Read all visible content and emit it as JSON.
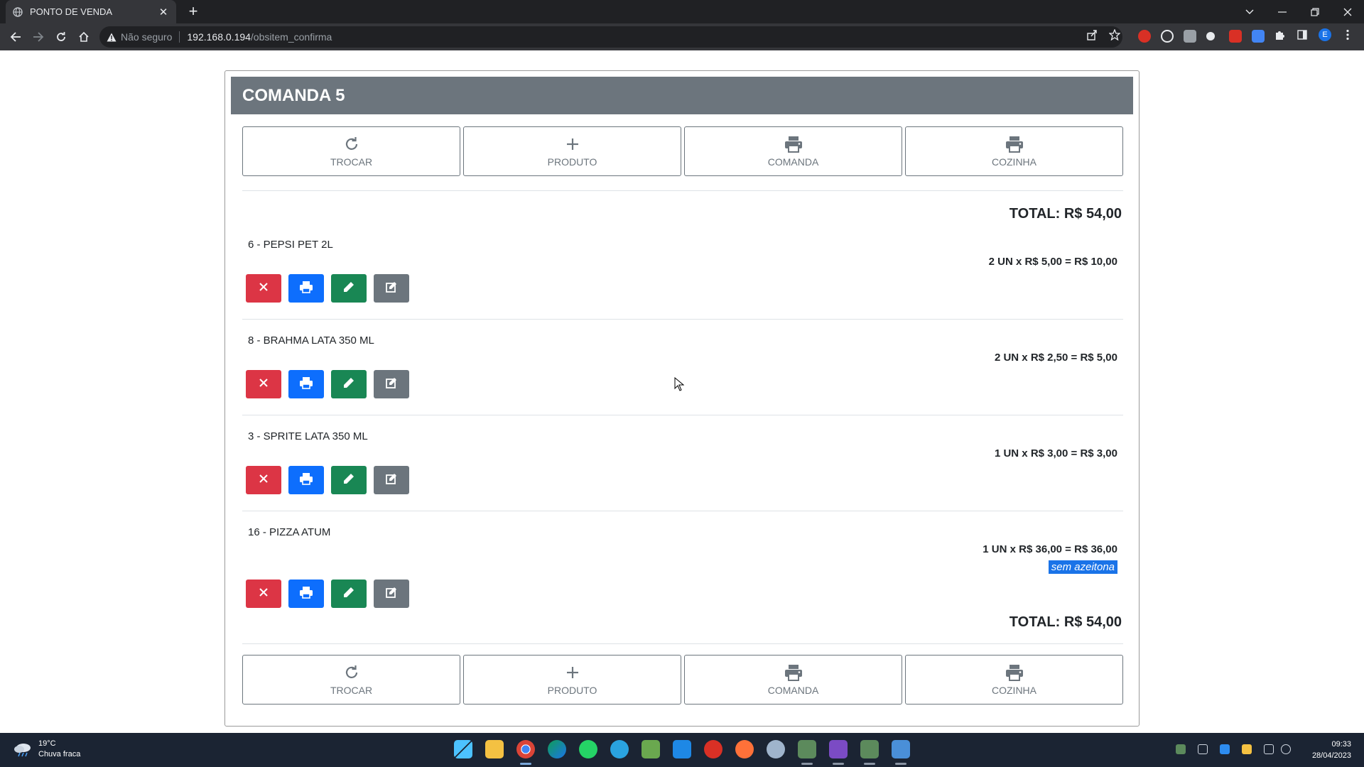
{
  "browser": {
    "tab_title": "PONTO DE VENDA",
    "tab_close": "✕",
    "new_tab": "+",
    "security_label": "Não seguro",
    "url_host": "192.168.0.194",
    "url_path": "/obsitem_confirma"
  },
  "page": {
    "title": "COMANDA 5",
    "buttons": [
      {
        "label": "TROCAR",
        "icon": "refresh-icon"
      },
      {
        "label": "PRODUTO",
        "icon": "plus-icon"
      },
      {
        "label": "COMANDA",
        "icon": "printer-icon"
      },
      {
        "label": "COZINHA",
        "icon": "printer-icon"
      }
    ],
    "total_top": "TOTAL: R$ 54,00",
    "total_bottom": "TOTAL: R$ 54,00",
    "items": [
      {
        "name": "6 - PEPSI PET 2L",
        "calc": "2 UN x R$ 5,00 = R$ 10,00",
        "obs": ""
      },
      {
        "name": "8 - BRAHMA LATA 350 ML",
        "calc": "2 UN x R$ 2,50 = R$ 5,00",
        "obs": ""
      },
      {
        "name": "3 - SPRITE LATA 350 ML",
        "calc": "1 UN x R$ 3,00 = R$ 3,00",
        "obs": ""
      },
      {
        "name": "16 - PIZZA ATUM",
        "calc": "1 UN x R$ 36,00 = R$ 36,00",
        "obs": "sem azeitona"
      }
    ],
    "item_action_icons": [
      "close-icon",
      "printer-icon",
      "pencil-icon",
      "edit-note-icon"
    ]
  },
  "taskbar": {
    "weather_temp": "19°C",
    "weather_desc": "Chuva fraca",
    "time": "09:33",
    "date": "28/04/2023"
  },
  "colors": {
    "header_bg": "#6c757d",
    "danger": "#dc3545",
    "primary": "#0d6efd",
    "success": "#198754",
    "secondary": "#6c757d"
  }
}
